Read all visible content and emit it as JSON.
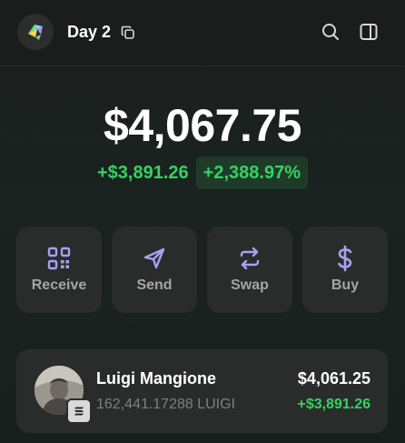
{
  "header": {
    "account_name": "Day 2",
    "logo_icon": "wallet-logo-icon",
    "copy_icon": "copy-icon",
    "search_icon": "search-icon",
    "panel_icon": "sidebar-panel-icon"
  },
  "portfolio": {
    "balance": "$4,067.75",
    "change_value": "+$3,891.26",
    "change_percent": "+2,388.97%"
  },
  "actions": [
    {
      "label": "Receive",
      "icon": "qr-code-icon"
    },
    {
      "label": "Send",
      "icon": "send-icon"
    },
    {
      "label": "Swap",
      "icon": "swap-icon"
    },
    {
      "label": "Buy",
      "icon": "dollar-icon"
    }
  ],
  "tokens": [
    {
      "name": "Luigi Mangione",
      "amount": "162,441.17288 LUIGI",
      "value": "$4,061.25",
      "change": "+$3,891.26",
      "chain_icon": "solana-chain-icon"
    }
  ],
  "colors": {
    "accent_purple": "#ab9ff2",
    "positive_green": "#36d163",
    "card_bg": "#2a2c2b"
  }
}
